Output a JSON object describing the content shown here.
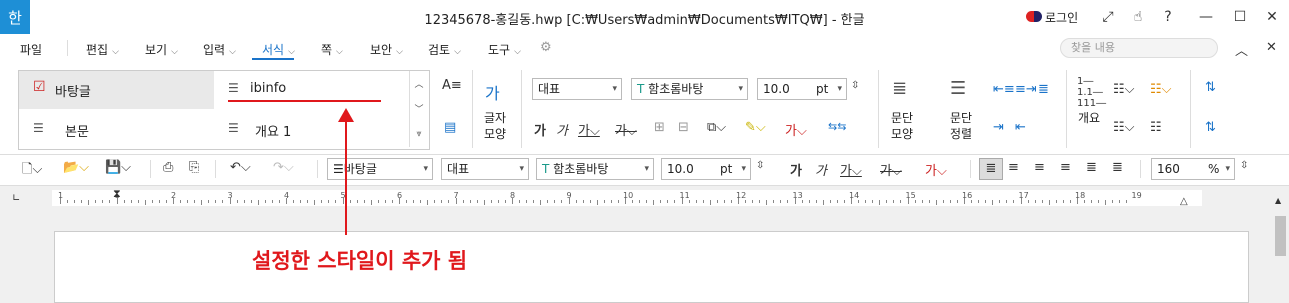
{
  "titlebar": {
    "app_icon": "한",
    "title": "12345678-홍길동.hwp [C:₩Users₩admin₩Documents₩ITQ₩] - 한글",
    "login_label": "로그인",
    "icons": [
      "restore-fullscreen-icon",
      "hand-icon",
      "help-icon",
      "minimize-icon",
      "maximize-icon",
      "close-icon"
    ]
  },
  "menu": {
    "items": [
      "파일",
      "편집",
      "보기",
      "입력",
      "서식",
      "쪽",
      "보안",
      "검토",
      "도구"
    ],
    "active": "서식",
    "search_placeholder": "찾을 내용"
  },
  "style_gallery": {
    "items": [
      "바탕글",
      "ibinfo",
      "본문",
      "개요 1"
    ],
    "selected": "바탕글"
  },
  "ribbon": {
    "char_shape_label_1": "글자",
    "char_shape_label_2": "모양",
    "style_combo": "대표",
    "font_combo": "함초롬바탕",
    "size_value": "10.0",
    "size_unit": "pt",
    "para_shape_label_1": "문단",
    "para_shape_label_2": "모양",
    "para_align_label_1": "문단",
    "para_align_label_2": "정렬",
    "outline_label": "개요"
  },
  "toolbar": {
    "style_combo": "바탕글",
    "lang_combo": "대표",
    "font_combo": "함초롬바탕",
    "size_value": "10.0",
    "size_unit": "pt",
    "zoom_value": "160",
    "zoom_unit": "%"
  },
  "ruler": {
    "numbers": [
      "1",
      "1",
      "2",
      "3",
      "4",
      "5",
      "6",
      "7",
      "8",
      "9",
      "10",
      "11",
      "12",
      "13",
      "14",
      "15",
      "16",
      "17",
      "18",
      "19"
    ]
  },
  "annotation": {
    "text": "설정한 스타일이 추가 됨",
    "color": "#e0181c"
  }
}
